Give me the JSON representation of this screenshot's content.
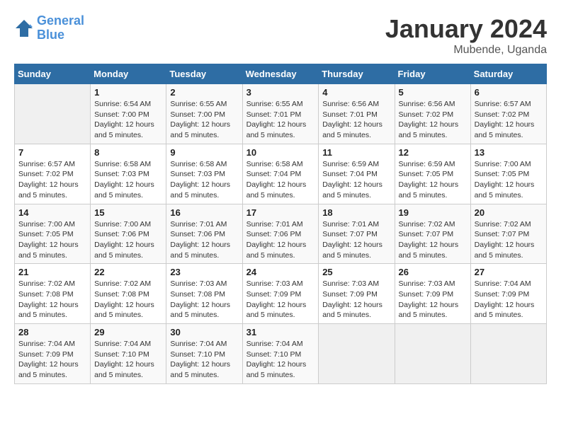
{
  "logo": {
    "line1": "General",
    "line2": "Blue"
  },
  "title": "January 2024",
  "subtitle": "Mubende, Uganda",
  "days_of_week": [
    "Sunday",
    "Monday",
    "Tuesday",
    "Wednesday",
    "Thursday",
    "Friday",
    "Saturday"
  ],
  "weeks": [
    [
      {
        "day": "",
        "info": ""
      },
      {
        "day": "1",
        "info": "Sunrise: 6:54 AM\nSunset: 7:00 PM\nDaylight: 12 hours\nand 5 minutes."
      },
      {
        "day": "2",
        "info": "Sunrise: 6:55 AM\nSunset: 7:00 PM\nDaylight: 12 hours\nand 5 minutes."
      },
      {
        "day": "3",
        "info": "Sunrise: 6:55 AM\nSunset: 7:01 PM\nDaylight: 12 hours\nand 5 minutes."
      },
      {
        "day": "4",
        "info": "Sunrise: 6:56 AM\nSunset: 7:01 PM\nDaylight: 12 hours\nand 5 minutes."
      },
      {
        "day": "5",
        "info": "Sunrise: 6:56 AM\nSunset: 7:02 PM\nDaylight: 12 hours\nand 5 minutes."
      },
      {
        "day": "6",
        "info": "Sunrise: 6:57 AM\nSunset: 7:02 PM\nDaylight: 12 hours\nand 5 minutes."
      }
    ],
    [
      {
        "day": "7",
        "info": "Sunrise: 6:57 AM\nSunset: 7:02 PM\nDaylight: 12 hours\nand 5 minutes."
      },
      {
        "day": "8",
        "info": "Sunrise: 6:58 AM\nSunset: 7:03 PM\nDaylight: 12 hours\nand 5 minutes."
      },
      {
        "day": "9",
        "info": "Sunrise: 6:58 AM\nSunset: 7:03 PM\nDaylight: 12 hours\nand 5 minutes."
      },
      {
        "day": "10",
        "info": "Sunrise: 6:58 AM\nSunset: 7:04 PM\nDaylight: 12 hours\nand 5 minutes."
      },
      {
        "day": "11",
        "info": "Sunrise: 6:59 AM\nSunset: 7:04 PM\nDaylight: 12 hours\nand 5 minutes."
      },
      {
        "day": "12",
        "info": "Sunrise: 6:59 AM\nSunset: 7:05 PM\nDaylight: 12 hours\nand 5 minutes."
      },
      {
        "day": "13",
        "info": "Sunrise: 7:00 AM\nSunset: 7:05 PM\nDaylight: 12 hours\nand 5 minutes."
      }
    ],
    [
      {
        "day": "14",
        "info": "Sunrise: 7:00 AM\nSunset: 7:05 PM\nDaylight: 12 hours\nand 5 minutes."
      },
      {
        "day": "15",
        "info": "Sunrise: 7:00 AM\nSunset: 7:06 PM\nDaylight: 12 hours\nand 5 minutes."
      },
      {
        "day": "16",
        "info": "Sunrise: 7:01 AM\nSunset: 7:06 PM\nDaylight: 12 hours\nand 5 minutes."
      },
      {
        "day": "17",
        "info": "Sunrise: 7:01 AM\nSunset: 7:06 PM\nDaylight: 12 hours\nand 5 minutes."
      },
      {
        "day": "18",
        "info": "Sunrise: 7:01 AM\nSunset: 7:07 PM\nDaylight: 12 hours\nand 5 minutes."
      },
      {
        "day": "19",
        "info": "Sunrise: 7:02 AM\nSunset: 7:07 PM\nDaylight: 12 hours\nand 5 minutes."
      },
      {
        "day": "20",
        "info": "Sunrise: 7:02 AM\nSunset: 7:07 PM\nDaylight: 12 hours\nand 5 minutes."
      }
    ],
    [
      {
        "day": "21",
        "info": "Sunrise: 7:02 AM\nSunset: 7:08 PM\nDaylight: 12 hours\nand 5 minutes."
      },
      {
        "day": "22",
        "info": "Sunrise: 7:02 AM\nSunset: 7:08 PM\nDaylight: 12 hours\nand 5 minutes."
      },
      {
        "day": "23",
        "info": "Sunrise: 7:03 AM\nSunset: 7:08 PM\nDaylight: 12 hours\nand 5 minutes."
      },
      {
        "day": "24",
        "info": "Sunrise: 7:03 AM\nSunset: 7:09 PM\nDaylight: 12 hours\nand 5 minutes."
      },
      {
        "day": "25",
        "info": "Sunrise: 7:03 AM\nSunset: 7:09 PM\nDaylight: 12 hours\nand 5 minutes."
      },
      {
        "day": "26",
        "info": "Sunrise: 7:03 AM\nSunset: 7:09 PM\nDaylight: 12 hours\nand 5 minutes."
      },
      {
        "day": "27",
        "info": "Sunrise: 7:04 AM\nSunset: 7:09 PM\nDaylight: 12 hours\nand 5 minutes."
      }
    ],
    [
      {
        "day": "28",
        "info": "Sunrise: 7:04 AM\nSunset: 7:09 PM\nDaylight: 12 hours\nand 5 minutes."
      },
      {
        "day": "29",
        "info": "Sunrise: 7:04 AM\nSunset: 7:10 PM\nDaylight: 12 hours\nand 5 minutes."
      },
      {
        "day": "30",
        "info": "Sunrise: 7:04 AM\nSunset: 7:10 PM\nDaylight: 12 hours\nand 5 minutes."
      },
      {
        "day": "31",
        "info": "Sunrise: 7:04 AM\nSunset: 7:10 PM\nDaylight: 12 hours\nand 5 minutes."
      },
      {
        "day": "",
        "info": ""
      },
      {
        "day": "",
        "info": ""
      },
      {
        "day": "",
        "info": ""
      }
    ]
  ]
}
